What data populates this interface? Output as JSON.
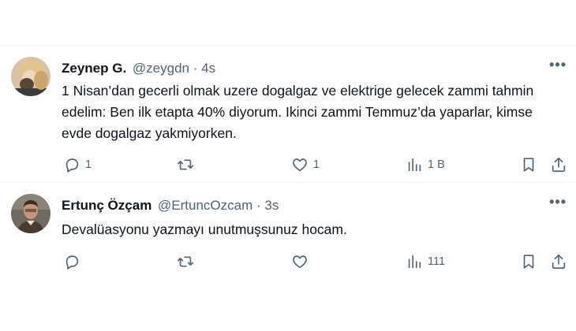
{
  "tweets": [
    {
      "display_name": "Zeynep G.",
      "handle": "@zeygdn",
      "separator": "·",
      "time": "4s",
      "more": "•••",
      "text": "1 Nisan’dan gecerli olmak uzere dogalgaz ve elektrige gelecek zammi tahmin edelim: Ben ilk etapta 40% diyorum. Ikinci zammi Temmuz’da yaparlar, kimse evde dogalgaz yakmiyorken.",
      "replies": "1",
      "retweets": "",
      "likes": "1",
      "views": "1 B"
    },
    {
      "display_name": "Ertunç Özçam",
      "handle": "@ErtuncOzcam",
      "separator": "·",
      "time": "3s",
      "more": "•••",
      "text": "Devalüasyonu yazmayı unutmuşsunuz hocam.",
      "replies": "",
      "retweets": "",
      "likes": "",
      "views": "111"
    }
  ],
  "icons": {
    "reply": "reply-icon",
    "retweet": "retweet-icon",
    "like": "heart-icon",
    "views": "views-chart-icon",
    "bookmark": "bookmark-icon",
    "share": "share-icon"
  },
  "colors": {
    "text_primary": "#0f1419",
    "text_secondary": "#536471",
    "divider": "#eff3f4"
  }
}
